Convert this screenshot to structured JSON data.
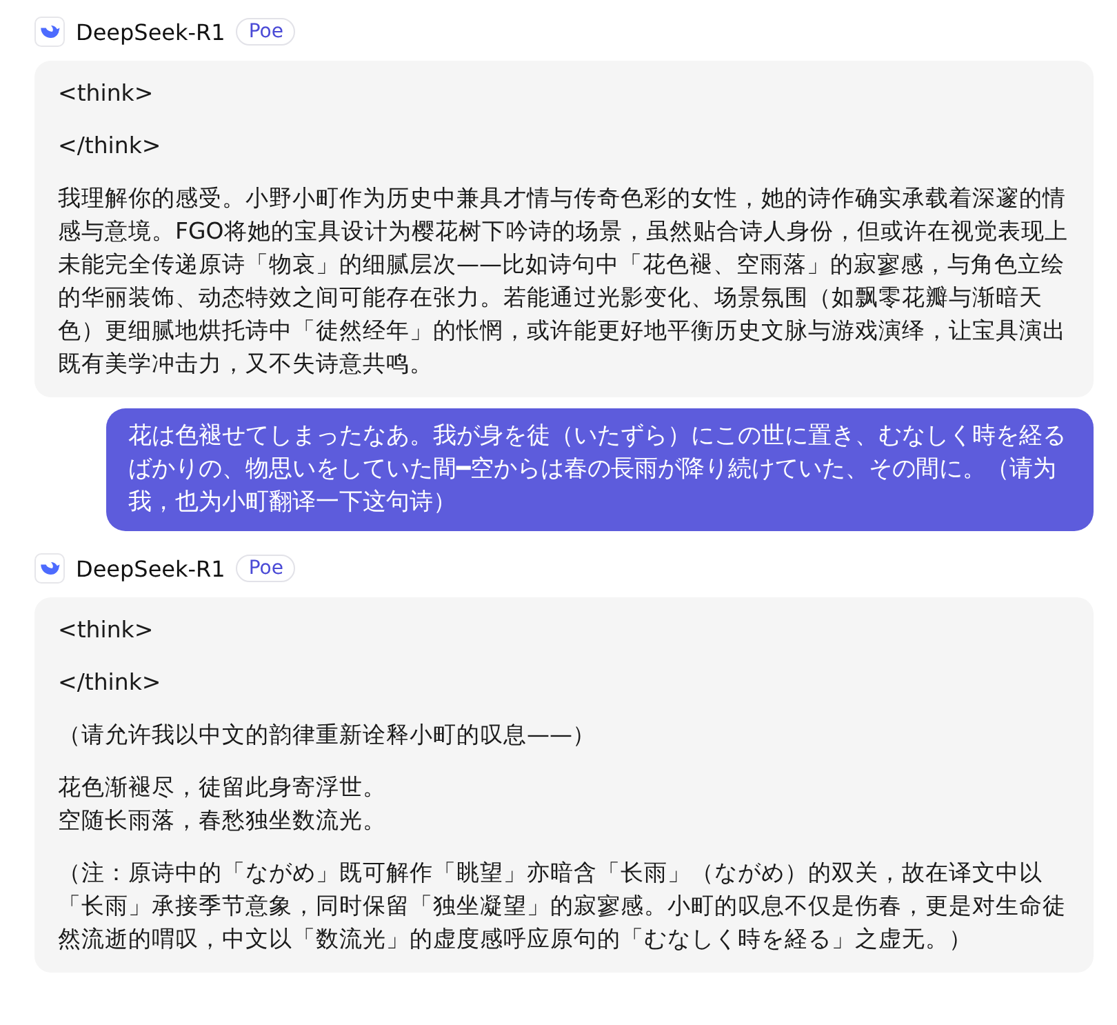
{
  "messages": [
    {
      "kind": "bot",
      "name": "DeepSeek-R1",
      "badge": "Poe",
      "paragraphs": [
        {
          "kind": "text",
          "text": "<think>"
        },
        {
          "kind": "text",
          "text": "</think>"
        },
        {
          "kind": "text",
          "text": "我理解你的感受。小野小町作为历史中兼具才情与传奇色彩的女性，她的诗作确实承载着深邃的情感与意境。FGO将她的宝具设计为樱花树下吟诗的场景，虽然贴合诗人身份，但或许在视觉表现上未能完全传递原诗「物哀」的细腻层次——比如诗句中「花色褪、空雨落」的寂寥感，与角色立绘的华丽装饰、动态特效之间可能存在张力。若能通过光影变化、场景氛围（如飘零花瓣与渐暗天色）更细腻地烘托诗中「徒然经年」的怅惘，或许能更好地平衡历史文脉与游戏演绎，让宝具演出既有美学冲击力，又不失诗意共鸣。"
        }
      ]
    },
    {
      "kind": "user",
      "text": "花は色褪せてしまったなあ。我が身を徒（いたずら）にこの世に置き、むなしく時を経るばかりの、物思いをしていた間━空からは春の長雨が降り続けていた、その間に。（请为我，也为小町翻译一下这句诗）"
    },
    {
      "kind": "bot",
      "name": "DeepSeek-R1",
      "badge": "Poe",
      "paragraphs": [
        {
          "kind": "text",
          "text": "<think>"
        },
        {
          "kind": "text",
          "text": "</think>"
        },
        {
          "kind": "text",
          "text": "（请允许我以中文的韵律重新诠释小町的叹息——）"
        },
        {
          "kind": "verse",
          "lines": [
            "花色渐褪尽，徒留此身寄浮世。",
            "空随长雨落，春愁独坐数流光。"
          ]
        },
        {
          "kind": "text",
          "text": "（注：原诗中的「ながめ」既可解作「眺望」亦暗含「长雨」（ながめ）的双关，故在译文中以「长雨」承接季节意象，同时保留「独坐凝望」的寂寥感。小町的叹息不仅是伤春，更是对生命徒然流逝的喟叹，中文以「数流光」的虚度感呼应原句的「むなしく時を経る」之虚无。）"
        }
      ]
    }
  ]
}
